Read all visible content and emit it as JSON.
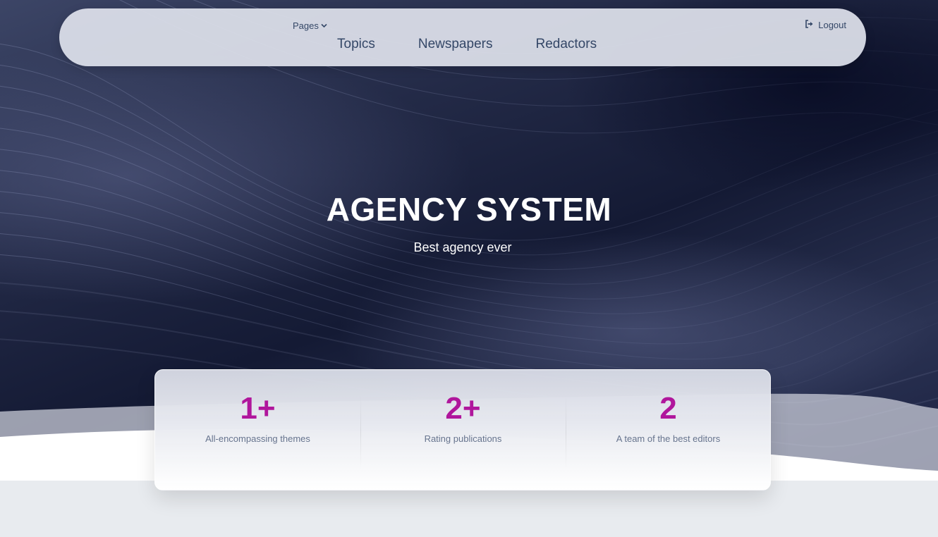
{
  "navbar": {
    "pages_label": "Pages",
    "links": [
      {
        "label": "Topics"
      },
      {
        "label": "Newspapers"
      },
      {
        "label": "Redactors"
      }
    ],
    "logout_label": "Logout"
  },
  "hero": {
    "title": "AGENCY SYSTEM",
    "subtitle": "Best agency ever"
  },
  "stats": [
    {
      "value": "1+",
      "label": "All-encompassing themes"
    },
    {
      "value": "2+",
      "label": "Rating publications"
    },
    {
      "value": "2",
      "label": "A team of the best editors"
    }
  ],
  "colors": {
    "accent": "#b0169c",
    "nav_text": "#344767",
    "hero_bg": "#141a34",
    "page_bg": "#e8ebef"
  },
  "icons": {
    "pages_dropdown": "chevron-down-icon",
    "logout": "logout-icon"
  }
}
